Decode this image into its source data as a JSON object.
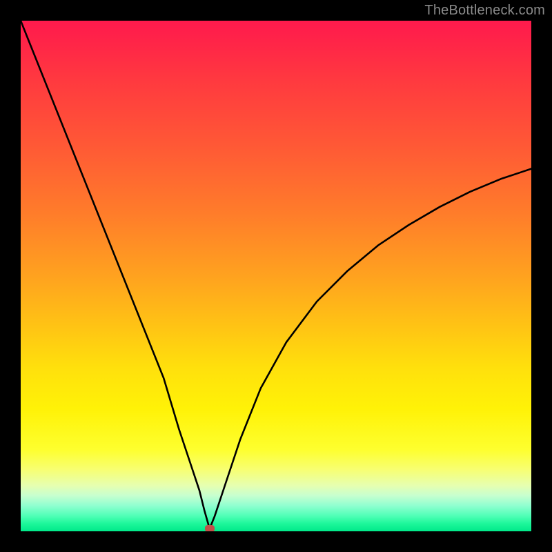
{
  "watermark": "TheBottleneck.com",
  "colors": {
    "curve_stroke": "#000000",
    "dot_fill": "#c05048",
    "frame": "#000000"
  },
  "chart_data": {
    "type": "line",
    "title": "",
    "xlabel": "",
    "ylabel": "",
    "xlim": [
      0,
      100
    ],
    "ylim": [
      0,
      100
    ],
    "grid": false,
    "legend": false,
    "series": [
      {
        "name": "bottleneck-curve",
        "x": [
          0,
          4,
          8,
          12,
          16,
          20,
          24,
          28,
          31,
          33,
          35,
          36,
          37,
          38,
          40,
          43,
          47,
          52,
          58,
          64,
          70,
          76,
          82,
          88,
          94,
          100
        ],
        "y": [
          100,
          90,
          80,
          70,
          60,
          50,
          40,
          30,
          20,
          14,
          8,
          4,
          0.5,
          3,
          9,
          18,
          28,
          37,
          45,
          51,
          56,
          60,
          63.5,
          66.5,
          69,
          71
        ]
      }
    ],
    "marker": {
      "x": 37,
      "y": 0.5
    }
  }
}
